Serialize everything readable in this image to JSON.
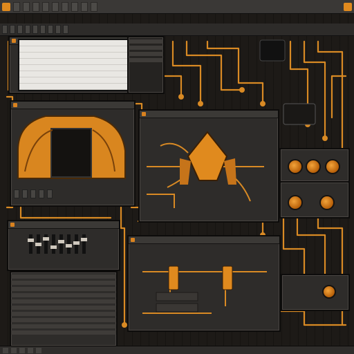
{
  "menubar": {
    "items": [
      "",
      "",
      "",
      "",
      "",
      "",
      "",
      "",
      "",
      ""
    ]
  },
  "toolbar": {
    "items": [
      "",
      "",
      "",
      "",
      "",
      "",
      "",
      "",
      "",
      ""
    ]
  },
  "editor": {
    "title": ""
  },
  "listing": {
    "rows": [
      "",
      "",
      "",
      "",
      "",
      "",
      "",
      ""
    ]
  },
  "center": {
    "title": ""
  },
  "bottom": {
    "title": ""
  },
  "status": {
    "items": [
      "",
      "",
      "",
      "",
      ""
    ]
  },
  "colors": {
    "accent": "#e08a1e",
    "panel": "#2e2c2a",
    "trace": "#d98a24",
    "background": "#1d1a17"
  },
  "icons": [
    "app-icon",
    "orange-knob-icon",
    "chip-icon",
    "gear-icon"
  ]
}
